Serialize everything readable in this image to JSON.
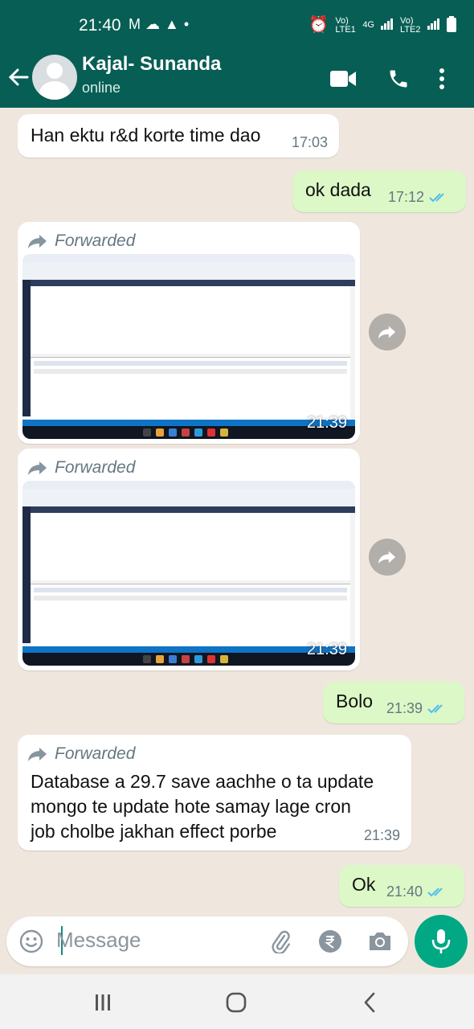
{
  "status_bar": {
    "time": "21:40",
    "icons_left": [
      "gmail-icon",
      "cloud-icon",
      "alert-icon",
      "dot-icon"
    ],
    "icons_right": [
      "alarm-icon",
      "volte1-icon",
      "4g-icon",
      "signal1-icon",
      "volte2-icon",
      "signal2-icon",
      "battery-icon"
    ],
    "sim1_label": "Vo) LTE1",
    "net_label": "4G",
    "sim2_label": "Vo) LTE2"
  },
  "header": {
    "contact_name": "Kajal- Sunanda",
    "presence": "online"
  },
  "messages": [
    {
      "dir": "in",
      "text": "Han ektu r&d korte time dao",
      "time": "17:03"
    },
    {
      "dir": "out",
      "text": "ok dada",
      "time": "17:12"
    },
    {
      "dir": "in",
      "forwarded": "Forwarded",
      "type": "image",
      "time": "21:39"
    },
    {
      "dir": "in",
      "forwarded": "Forwarded",
      "type": "image",
      "time": "21:39"
    },
    {
      "dir": "out",
      "text": "Bolo",
      "time": "21:39"
    },
    {
      "dir": "in",
      "forwarded": "Forwarded",
      "text_lines": [
        "Database a 29.7 save aachhe o ta update",
        "mongo te update hote samay lage  cron",
        "job cholbe jakhan effect porbe"
      ],
      "time": "21:39"
    },
    {
      "dir": "out",
      "text": "Ok",
      "time": "21:40"
    }
  ],
  "composer": {
    "placeholder": "Message"
  },
  "colors": {
    "header": "#075e54",
    "outgoing_bubble": "#dcf8c6",
    "incoming_bubble": "#ffffff",
    "chat_bg": "#efe7de",
    "mic_button": "#00a884",
    "read_ticks": "#53bdeb"
  }
}
